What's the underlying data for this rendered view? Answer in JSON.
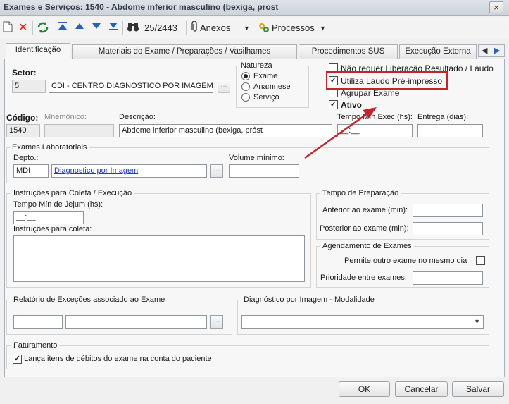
{
  "window": {
    "title": "Exames e Serviços: 1540 - Abdome inferior masculino (bexiga, prost",
    "close_icon": "×"
  },
  "toolbar": {
    "counter": "25/2443",
    "anexos_label": "Anexos",
    "processos_label": "Processos"
  },
  "tabs": [
    {
      "label": "Identificação"
    },
    {
      "label": "Materiais do Exame / Preparações / Vasilhames"
    },
    {
      "label": "Procedimentos SUS"
    },
    {
      "label": "Execução Externa"
    }
  ],
  "setor": {
    "label": "Setor:",
    "code": "5",
    "name": "CDI - CENTRO DIAGNOSTICO POR IMAGEM"
  },
  "natureza": {
    "label": "Natureza",
    "options": [
      "Exame",
      "Anamnese",
      "Serviço"
    ],
    "selected": "Exame"
  },
  "flags": {
    "nao_requer": "Não requer Liberação Resultado / Laudo",
    "utiliza_laudo": "Utiliza Laudo Pré-impresso",
    "agrupar": "Agrupar Exame",
    "ativo": "Ativo"
  },
  "codigo": {
    "label": "Código:",
    "value": "1540"
  },
  "mnemonico": {
    "label": "Mnemônico:",
    "value": ""
  },
  "descricao": {
    "label": "Descrição:",
    "value": "Abdome inferior masculino (bexiga, próst"
  },
  "tempo_min_exec": {
    "label": "Tempo Mín Exec (hs):",
    "value": "__:__"
  },
  "entrega": {
    "label": "Entrega (dias):",
    "value": ""
  },
  "exames_lab": {
    "title": "Exames Laboratoriais",
    "depto_label": "Depto.:",
    "depto_code": "MDI",
    "depto_name": "Diagnostico por Imagem",
    "volume_label": "Volume mínimo:",
    "volume_value": ""
  },
  "instrucoes": {
    "title": "Instruções para Coleta / Execução",
    "jejum_label": "Tempo Mín de Jejum (hs):",
    "jejum_value": "__:__",
    "coleta_label": "Instruções para coleta:",
    "coleta_value": ""
  },
  "tempo_prep": {
    "title": "Tempo de Preparação",
    "anterior_label": "Anterior ao exame (min):",
    "posterior_label": "Posterior ao exame (min):"
  },
  "agendamento": {
    "title": "Agendamento de Exames",
    "permite_label": "Permite outro exame no mesmo dia",
    "prioridade_label": "Prioridade entre exames:"
  },
  "relatorio": {
    "title": "Relatório de Exceções associado ao Exame"
  },
  "diag_imagem": {
    "title": "Diagnóstico por Imagem - Modalidade",
    "selected": ""
  },
  "faturamento": {
    "title": "Faturamento",
    "lanca_label": "Lança itens de débitos do exame na conta do paciente"
  },
  "buttons": {
    "ok": "OK",
    "cancelar": "Cancelar",
    "salvar": "Salvar",
    "ellipsis": "..."
  },
  "colors": {
    "highlight": "#c0262d",
    "arrow": "#c0262d",
    "link": "#1c3ec4"
  }
}
